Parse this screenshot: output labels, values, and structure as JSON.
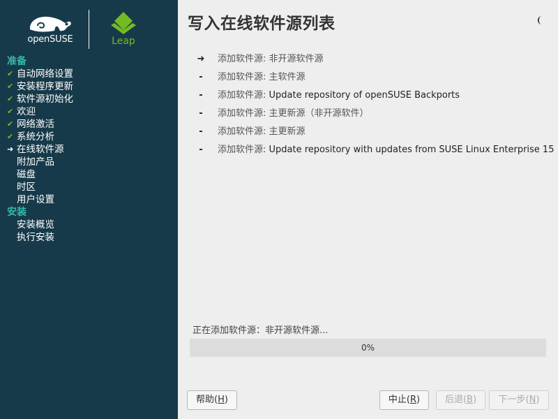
{
  "logos": {
    "opensuse": "openSUSE",
    "leap": "Leap"
  },
  "sidebar": {
    "groups": [
      {
        "label": "准备",
        "items": [
          {
            "label": "自动网络设置",
            "state": "done"
          },
          {
            "label": "安装程序更新",
            "state": "done"
          },
          {
            "label": "软件源初始化",
            "state": "done"
          },
          {
            "label": "欢迎",
            "state": "done"
          },
          {
            "label": "网络激活",
            "state": "done"
          },
          {
            "label": "系统分析",
            "state": "done"
          },
          {
            "label": "在线软件源",
            "state": "current"
          },
          {
            "label": "附加产品",
            "state": "pending"
          },
          {
            "label": "磁盘",
            "state": "pending"
          },
          {
            "label": "时区",
            "state": "pending"
          },
          {
            "label": "用户设置",
            "state": "pending"
          }
        ]
      },
      {
        "label": "安装",
        "items": [
          {
            "label": "安装概览",
            "state": "pending"
          },
          {
            "label": "执行安装",
            "state": "pending"
          }
        ]
      }
    ],
    "marks": {
      "done": "✔",
      "current": "➜"
    }
  },
  "main": {
    "title": "写入在线软件源列表",
    "theme_icon": "moon-icon",
    "repos": [
      {
        "bullet": "➜",
        "prefix": "添加软件源: ",
        "name": "非开源软件源"
      },
      {
        "bullet": "-",
        "prefix": "添加软件源: ",
        "name": "主软件源"
      },
      {
        "bullet": "-",
        "prefix": "添加软件源: ",
        "name": "Update repository of openSUSE Backports"
      },
      {
        "bullet": "-",
        "prefix": "添加软件源: ",
        "name": "主更新源（非开源软件）"
      },
      {
        "bullet": "-",
        "prefix": "添加软件源: ",
        "name": "主更新源"
      },
      {
        "bullet": "-",
        "prefix": "添加软件源: ",
        "name": "Update repository with updates from SUSE Linux Enterprise 15"
      }
    ],
    "status": "正在添加软件源：非开源软件源...",
    "progress": {
      "value": 0,
      "label": "0%"
    }
  },
  "buttons": {
    "help": {
      "label": "帮助(",
      "key": "H",
      "suffix": ")"
    },
    "abort": {
      "label": "中止(",
      "key": "R",
      "suffix": ")"
    },
    "back": {
      "label": "后退(",
      "key": "B",
      "suffix": ")"
    },
    "next": {
      "label": "下一步(",
      "key": "N",
      "suffix": ")"
    }
  },
  "colors": {
    "sidebar_bg": "#173a4a",
    "accent_green": "#73ba25",
    "group_teal": "#35b9ab"
  }
}
